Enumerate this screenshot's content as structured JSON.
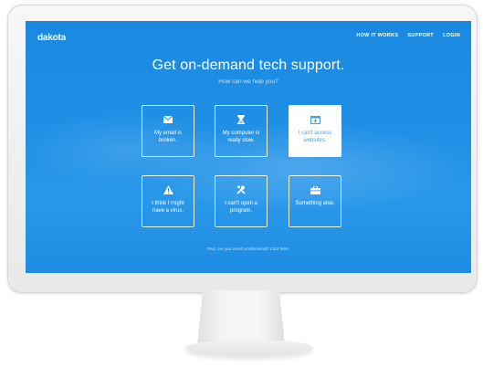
{
  "site": {
    "logo": "dakota",
    "nav": [
      "HOW IT WORKS",
      "SUPPORT",
      "LOGIN"
    ]
  },
  "hero": {
    "headline": "Get on-demand tech support.",
    "subhead": "How can we help you?"
  },
  "options": [
    {
      "icon": "envelope-icon",
      "label": "My email is broken."
    },
    {
      "icon": "hourglass-icon",
      "label": "My computer is really slow."
    },
    {
      "icon": "browser-window-icon",
      "label": "I can't access websites.",
      "selected": true
    },
    {
      "icon": "warning-triangle-icon",
      "label": "I think I might have a virus."
    },
    {
      "icon": "tools-icon",
      "label": "I can't open a program."
    },
    {
      "icon": "briefcase-icon",
      "label": "Something else."
    }
  ],
  "footer": {
    "professional_link": "Psst, are you a tech professional? Click here."
  }
}
